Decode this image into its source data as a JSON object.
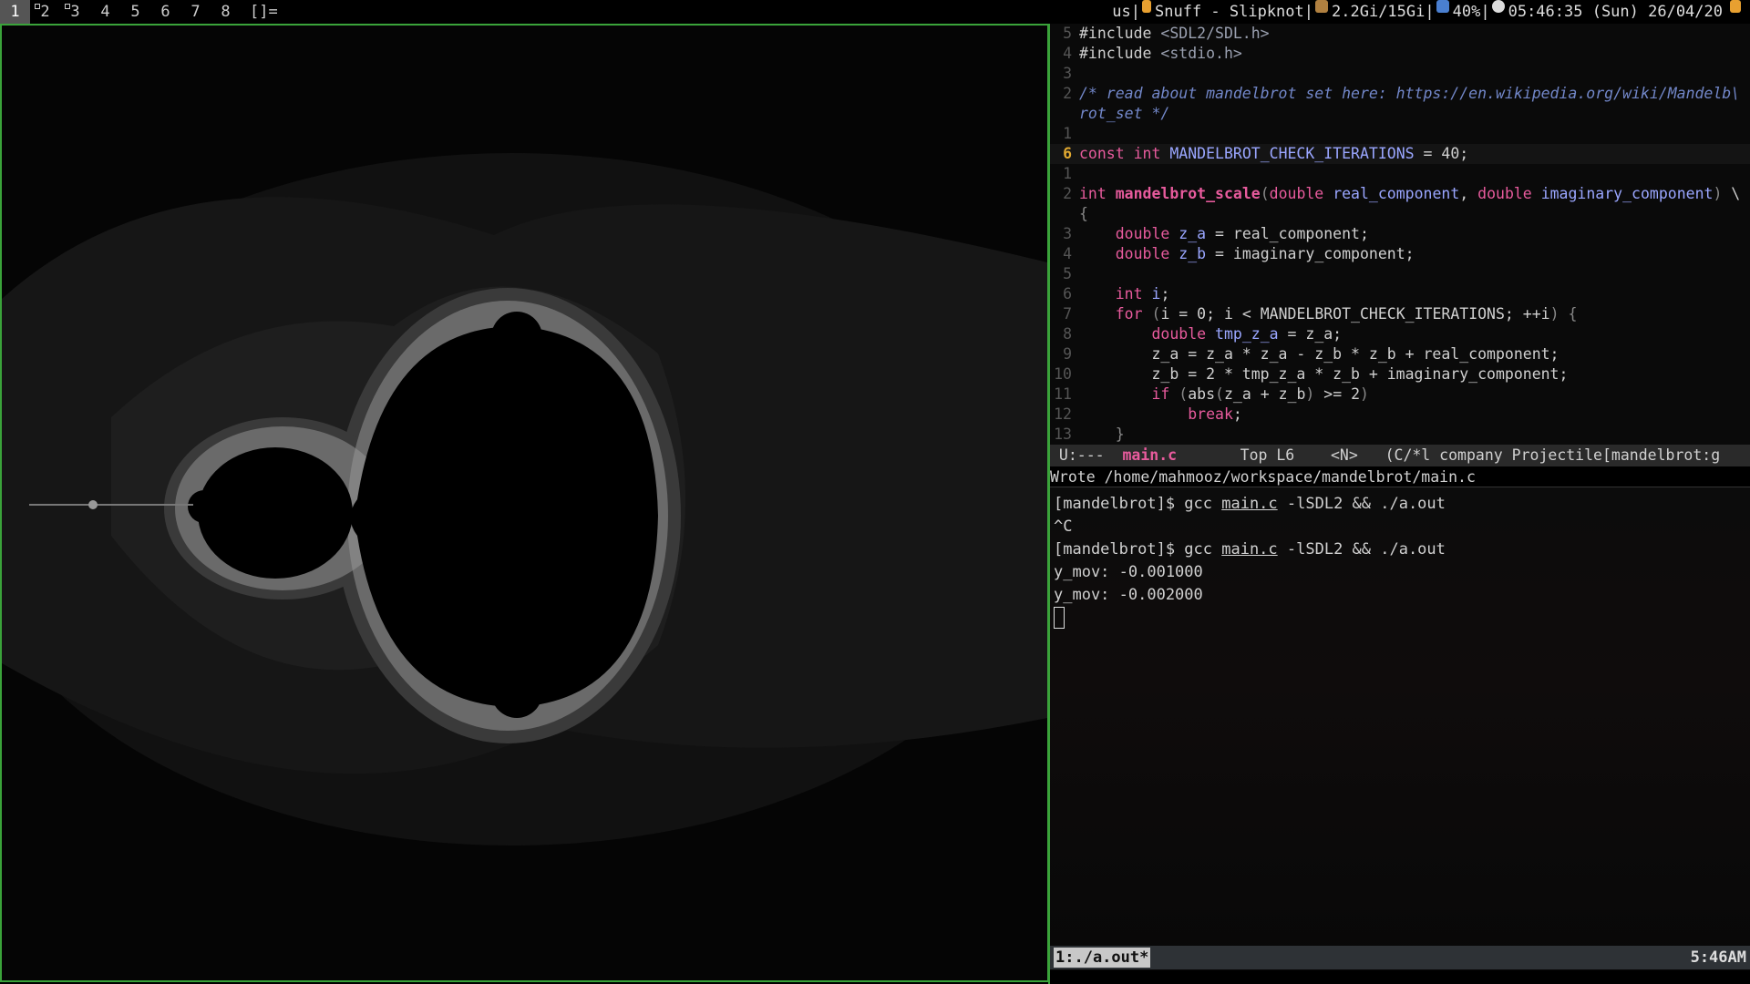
{
  "topbar": {
    "tags": [
      "1",
      "2",
      "3",
      "4",
      "5",
      "6",
      "7",
      "8"
    ],
    "selected_tag": "1",
    "layout_symbol": "[]=",
    "keyboard": "us",
    "song": "Snuff - Slipknot",
    "memory": "2.2Gi/15Gi",
    "volume": "40%",
    "datetime": "05:46:35 (Sun) 26/04/20",
    "icons": [
      "music-icon",
      "memory-icon",
      "volume-icon",
      "clock-icon",
      "battery-icon"
    ]
  },
  "editor": {
    "lines": [
      {
        "num": "5",
        "parts": [
          [
            "pl",
            "#include "
          ],
          [
            "str",
            "<SDL2/SDL.h>"
          ]
        ]
      },
      {
        "num": "4",
        "parts": [
          [
            "pl",
            "#include "
          ],
          [
            "str",
            "<stdio.h>"
          ]
        ]
      },
      {
        "num": "3",
        "parts": []
      },
      {
        "num": "2",
        "parts": [
          [
            "cm",
            "/* read about mandelbrot set here: https://en.wikipedia.org/wiki/Mandelb\\"
          ]
        ]
      },
      {
        "num": "",
        "parts": [
          [
            "cm",
            "rot_set */"
          ]
        ]
      },
      {
        "num": "1",
        "parts": []
      },
      {
        "num": "6",
        "current": true,
        "parts": [
          [
            "kw",
            "const "
          ],
          [
            "ty",
            "int "
          ],
          [
            "cst",
            "MANDELBROT_CHECK_ITERATIONS"
          ],
          [
            "pl",
            " = 40;"
          ]
        ]
      },
      {
        "num": "1",
        "parts": []
      },
      {
        "num": "2",
        "parts": [
          [
            "ty",
            "int "
          ],
          [
            "fn",
            "mandelbrot_scale"
          ],
          [
            "par",
            "("
          ],
          [
            "ty",
            "double "
          ],
          [
            "var",
            "real_component"
          ],
          [
            "pl",
            ", "
          ],
          [
            "ty",
            "double "
          ],
          [
            "var",
            "imaginary_component"
          ],
          [
            "par",
            ")"
          ],
          [
            "pl",
            " \\"
          ]
        ]
      },
      {
        "num": "",
        "parts": [
          [
            "par",
            "{"
          ]
        ]
      },
      {
        "num": "3",
        "parts": [
          [
            "pl",
            "    "
          ],
          [
            "ty",
            "double "
          ],
          [
            "var",
            "z_a"
          ],
          [
            "pl",
            " = real_component;"
          ]
        ]
      },
      {
        "num": "4",
        "parts": [
          [
            "pl",
            "    "
          ],
          [
            "ty",
            "double "
          ],
          [
            "var",
            "z_b"
          ],
          [
            "pl",
            " = imaginary_component;"
          ]
        ]
      },
      {
        "num": "5",
        "parts": []
      },
      {
        "num": "6",
        "parts": [
          [
            "pl",
            "    "
          ],
          [
            "ty",
            "int "
          ],
          [
            "var",
            "i"
          ],
          [
            "pl",
            ";"
          ]
        ]
      },
      {
        "num": "7",
        "parts": [
          [
            "pl",
            "    "
          ],
          [
            "kw",
            "for "
          ],
          [
            "par",
            "("
          ],
          [
            "pl",
            "i = 0; i < MANDELBROT_CHECK_ITERATIONS; ++i"
          ],
          [
            "par",
            ")"
          ],
          [
            "pl",
            " "
          ],
          [
            "par",
            "{"
          ]
        ]
      },
      {
        "num": "8",
        "parts": [
          [
            "pl",
            "        "
          ],
          [
            "ty",
            "double "
          ],
          [
            "var",
            "tmp_z_a"
          ],
          [
            "pl",
            " = z_a;"
          ]
        ]
      },
      {
        "num": "9",
        "parts": [
          [
            "pl",
            "        z_a = z_a * z_a - z_b * z_b + real_component;"
          ]
        ]
      },
      {
        "num": "10",
        "parts": [
          [
            "pl",
            "        z_b = 2 * tmp_z_a * z_b + imaginary_component;"
          ]
        ]
      },
      {
        "num": "11",
        "parts": [
          [
            "pl",
            "        "
          ],
          [
            "kw",
            "if "
          ],
          [
            "par",
            "("
          ],
          [
            "pl",
            "abs"
          ],
          [
            "par",
            "("
          ],
          [
            "pl",
            "z_a + z_b"
          ],
          [
            "par",
            ")"
          ],
          [
            "pl",
            " >= 2"
          ],
          [
            "par",
            ")"
          ]
        ]
      },
      {
        "num": "12",
        "parts": [
          [
            "pl",
            "            "
          ],
          [
            "kw",
            "break"
          ],
          [
            "pl",
            ";"
          ]
        ]
      },
      {
        "num": "13",
        "parts": [
          [
            "pl",
            "    "
          ],
          [
            "par",
            "}"
          ]
        ]
      }
    ],
    "modeline": {
      "state": " U:---  ",
      "file": "main.c",
      "position": "       Top L6    <N>   (C/*l company Projectile[mandelbrot:g"
    },
    "echo": "Wrote /home/mahmooz/workspace/mandelbrot/main.c"
  },
  "terminal": {
    "lines": [
      {
        "prompt": "[mandelbrot]$ ",
        "cmd": "gcc ",
        "file": "main.c",
        "rest": " -lSDL2 && ./a.out"
      },
      {
        "text": "^C"
      },
      {
        "prompt": "[mandelbrot]$ ",
        "cmd": "gcc ",
        "file": "main.c",
        "rest": " -lSDL2 && ./a.out"
      },
      {
        "text": "y_mov: -0.001000"
      },
      {
        "text": "y_mov: -0.002000"
      }
    ],
    "tmux_window": "1:./a.out*",
    "tmux_clock": "5:46AM"
  },
  "colors": {
    "border": "#3aa33a",
    "keyword": "#e85b9d",
    "variable": "#9aa6ff",
    "comment": "#7287c9"
  }
}
